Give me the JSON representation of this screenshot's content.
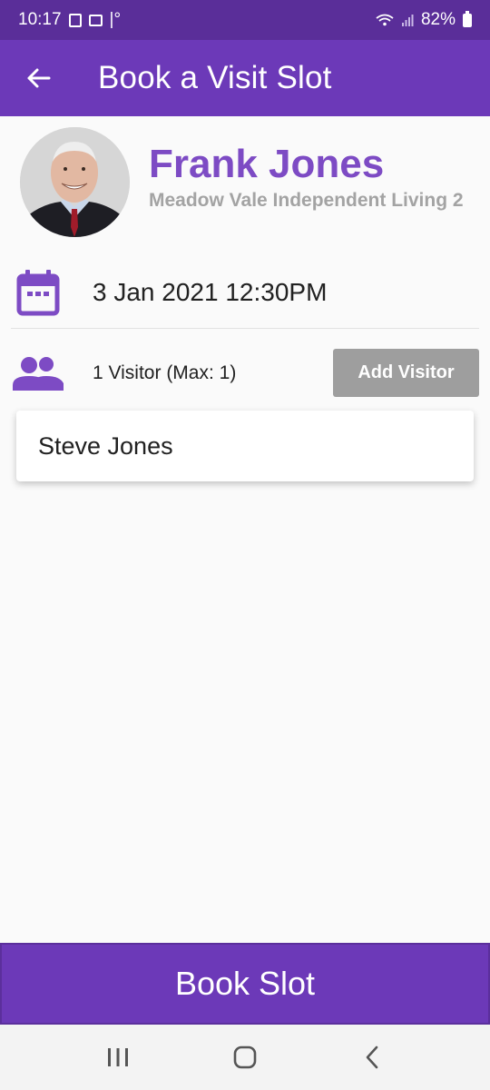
{
  "status_bar": {
    "time": "10:17",
    "temp_glyph": "|°",
    "battery": "82%"
  },
  "app_bar": {
    "title": "Book a Visit Slot",
    "back_icon": "arrow-left-icon"
  },
  "resident": {
    "name": "Frank Jones",
    "residence": "Meadow Vale Independent Living 2"
  },
  "visit": {
    "date_time": "3 Jan 2021 12:30PM",
    "visitor_count": "1 Visitor (Max: 1)",
    "add_visitor_label": "Add Visitor",
    "visitors": [
      {
        "name": "Steve Jones"
      }
    ]
  },
  "book_button_label": "Book Slot",
  "colors": {
    "primary": "#6c39b8",
    "status_bar": "#5a2e99",
    "accent_text": "#7d4bc4",
    "secondary_text": "#a3a3a3",
    "disabled_button": "#9e9e9e"
  },
  "nav_bar": {
    "recents_icon": "recents-icon",
    "home_icon": "home-icon",
    "back_icon": "chevron-left-icon"
  }
}
